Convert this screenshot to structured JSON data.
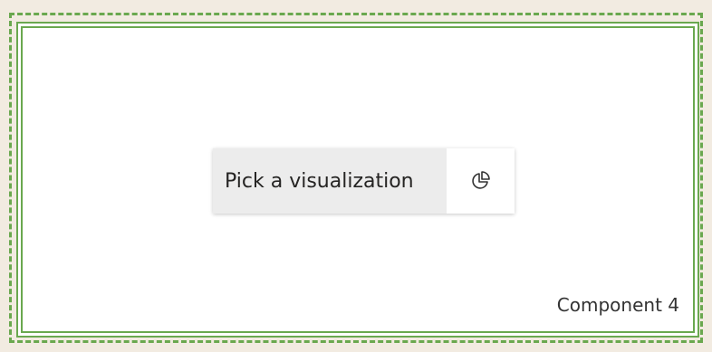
{
  "visual_placeholder": {
    "button_label": "Pick a visualization",
    "icon": "pie-chart-icon"
  },
  "component": {
    "name": "Component 4"
  },
  "colors": {
    "canvas_background": "#f2ebe1",
    "selection_border": "#6aa84f",
    "panel_background": "#ffffff",
    "button_background": "#ececec"
  }
}
